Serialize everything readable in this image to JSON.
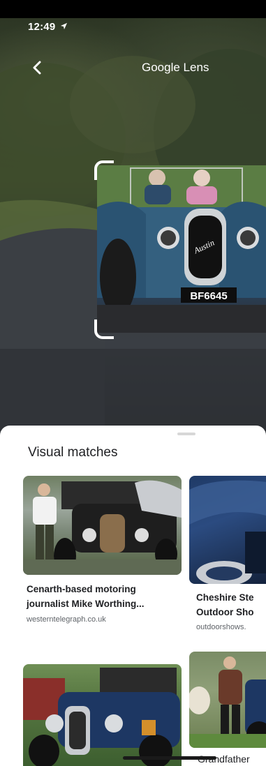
{
  "status_bar": {
    "time": "12:49",
    "location_icon": "location-arrow-icon"
  },
  "header": {
    "back_icon": "chevron-left-icon",
    "title": "Google Lens"
  },
  "selection": {
    "plate_text": "BF6645",
    "badge_text": "Austin"
  },
  "results": {
    "section_title": "Visual matches",
    "cards": [
      {
        "title_line1": "Cenarth-based motoring",
        "title_line2": "journalist Mike Worthing...",
        "source": "westerntelegraph.co.uk"
      },
      {
        "title_line1": "Cheshire Ste",
        "title_line2": "Outdoor Sho",
        "source": "outdoorshows."
      },
      {
        "title_line1": "",
        "title_line2": "",
        "source": ""
      },
      {
        "title_line1": "Grandfather",
        "title_line2": "",
        "source": ""
      }
    ]
  },
  "colors": {
    "accent_white": "#ffffff",
    "sheet_bg": "#ffffff",
    "text_primary": "#202124",
    "text_secondary": "#5f6368"
  }
}
